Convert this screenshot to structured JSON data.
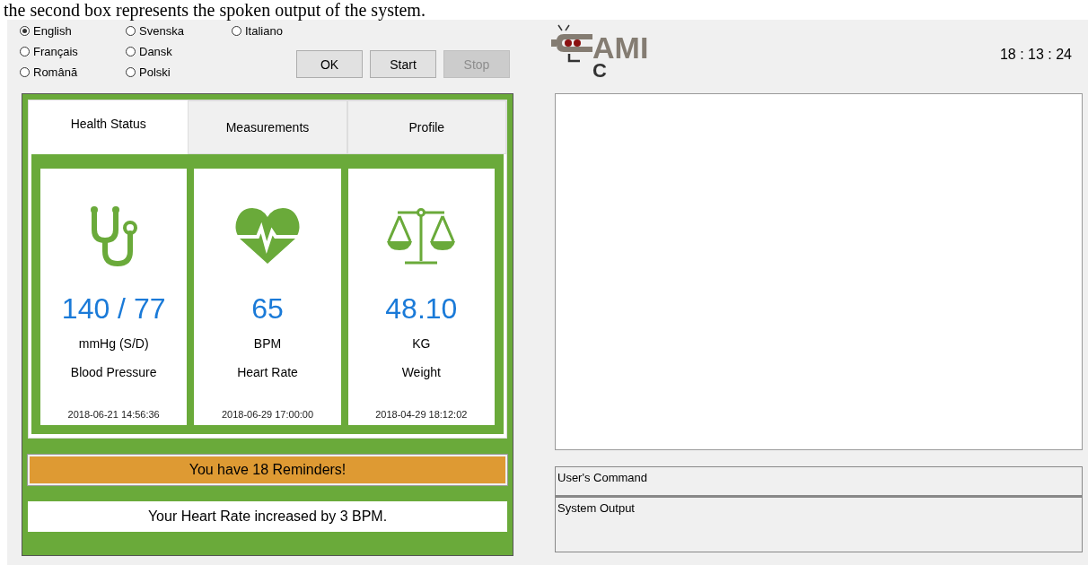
{
  "caption": "the second box represents the spoken output of the system.",
  "languages": [
    {
      "label": "English",
      "selected": true
    },
    {
      "label": "Français",
      "selected": false
    },
    {
      "label": "Română",
      "selected": false
    },
    {
      "label": "Svenska",
      "selected": false
    },
    {
      "label": "Dansk",
      "selected": false
    },
    {
      "label": "Polski",
      "selected": false
    },
    {
      "label": "Italiano",
      "selected": false
    }
  ],
  "buttons": [
    {
      "label": "OK",
      "disabled": false
    },
    {
      "label": "Start",
      "disabled": false
    },
    {
      "label": "Stop",
      "disabled": true
    }
  ],
  "logo": {
    "text": "AMI",
    "sub": "C"
  },
  "clock": "18 : 13 : 24",
  "tabs": [
    {
      "label": "Health Status",
      "selected": true
    },
    {
      "label": "Measurements",
      "selected": false
    },
    {
      "label": "Profile",
      "selected": false
    }
  ],
  "cards": [
    {
      "kind": "stethoscope",
      "value": "140 / 77",
      "unit": "mmHg (S/D)",
      "name": "Blood Pressure",
      "time": "2018-06-21 14:56:36"
    },
    {
      "kind": "heart",
      "value": "65",
      "unit": "BPM",
      "name": "Heart Rate",
      "time": "2018-06-29 17:00:00"
    },
    {
      "kind": "scale",
      "value": "48.10",
      "unit": "KG",
      "name": "Weight",
      "time": "2018-04-29 18:12:02"
    }
  ],
  "reminder": "You have 18 Reminders!",
  "message": "Your Heart Rate increased by 3 BPM.",
  "output_boxes": [
    {
      "label": "User's Command"
    },
    {
      "label": "System Output"
    }
  ]
}
